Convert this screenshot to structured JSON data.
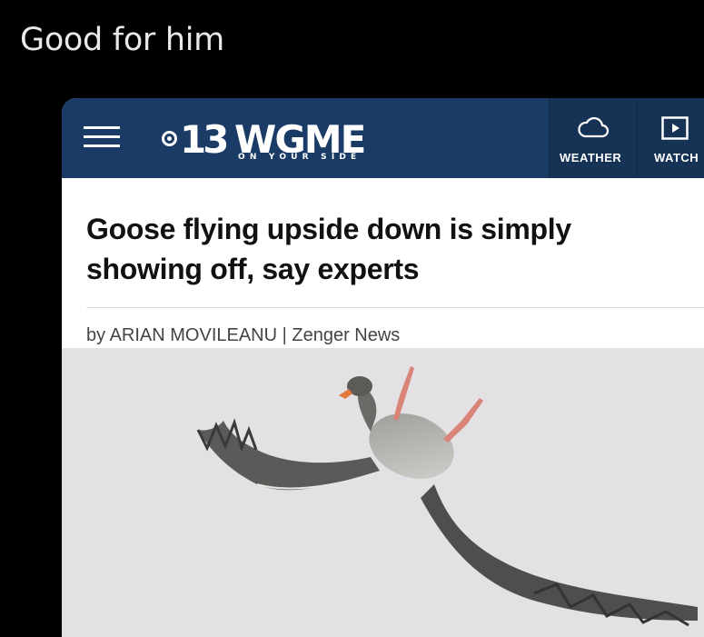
{
  "post": {
    "caption": "Good for him"
  },
  "site": {
    "logo_number": "13",
    "logo_callsign": "WGME",
    "logo_tagline": "ON YOUR SIDE",
    "brand_color": "#1a3b66"
  },
  "nav": {
    "weather_label": "WEATHER",
    "watch_label": "WATCH",
    "icons": [
      "menu-icon",
      "cloud-icon",
      "play-icon"
    ]
  },
  "article": {
    "headline": "Goose flying upside down is simply showing off, say experts",
    "byline": "by ARIAN MOVILEANU | Zenger News"
  }
}
